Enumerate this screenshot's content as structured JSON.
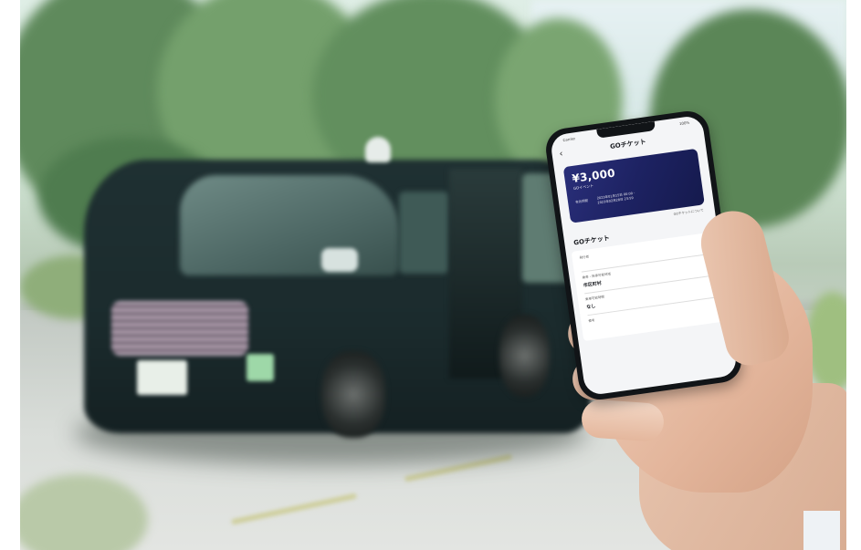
{
  "phone": {
    "status_left": "Carrier",
    "status_right": "100%",
    "nav_title": "GOチケット",
    "back_icon": "‹",
    "ticket": {
      "amount": "¥3,000",
      "event": "GOイベント",
      "period_label": "有効期間",
      "period_start": "2023年01月15日 00:00 -",
      "period_end": "2023年02月28日 23:59"
    },
    "help_link": "GOチケットについて",
    "section_title": "GOチケット",
    "fields": [
      {
        "label": "発行者",
        "value": ""
      },
      {
        "label": "乗車・降車可能地域",
        "value": "市区町村"
      },
      {
        "label": "乗車可能時間",
        "value": "なし"
      },
      {
        "label": "備考",
        "value": ""
      }
    ]
  },
  "colors": {
    "ticket_card": "#1d2262",
    "taxi_body": "#1b2b2d",
    "background": "#cfe3d3"
  }
}
